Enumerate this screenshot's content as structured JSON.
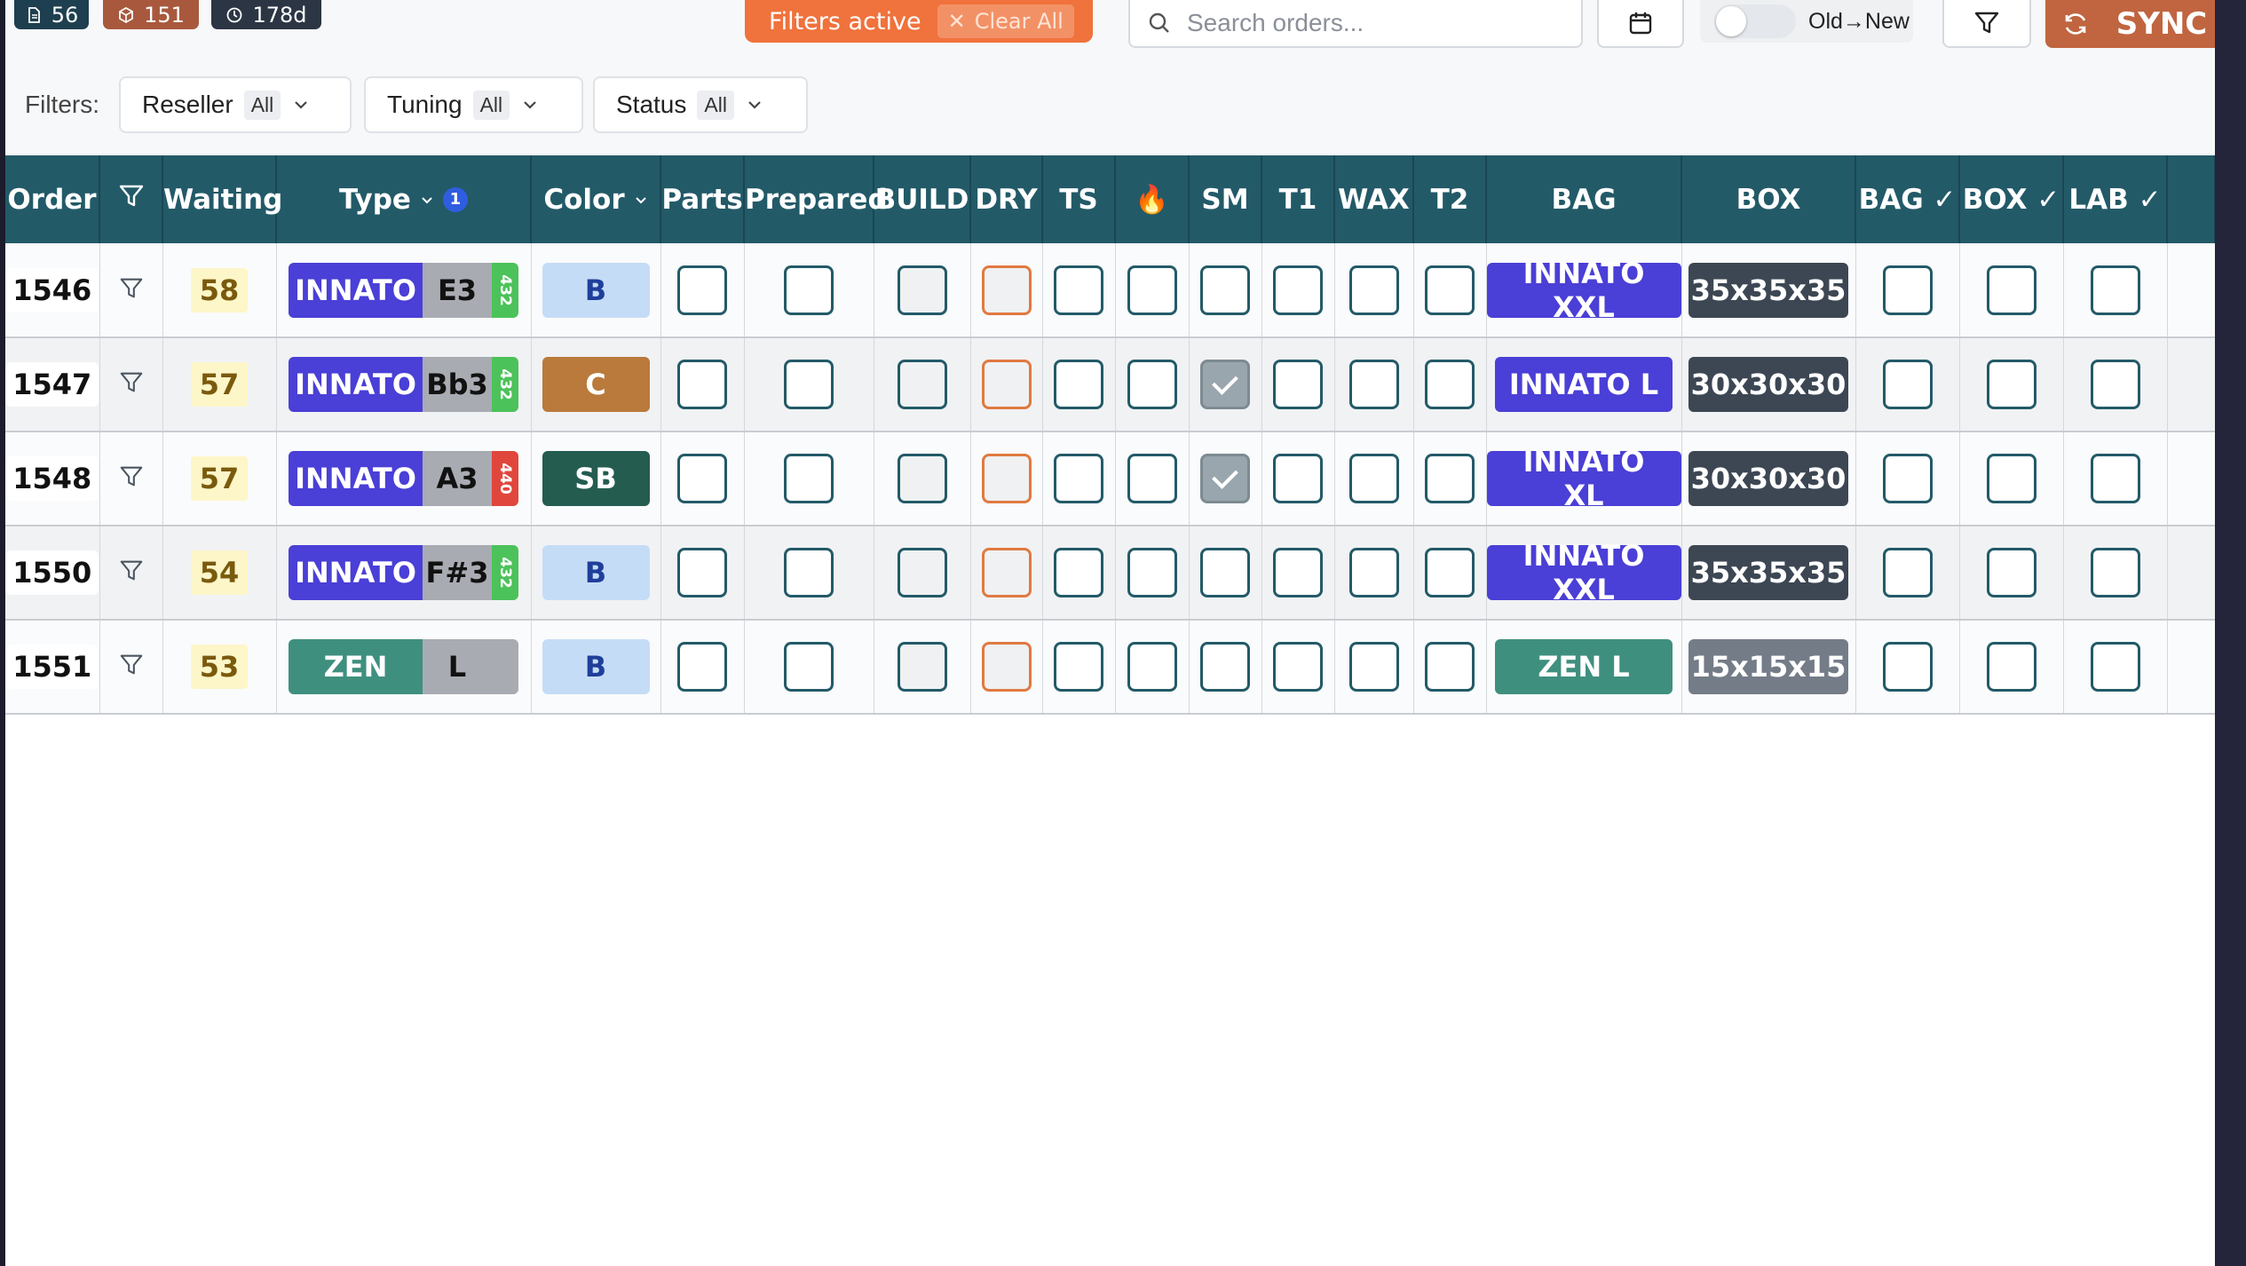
{
  "stats": {
    "docs": "56",
    "boxes": "151",
    "time": "178d",
    "docs_color": "#1e3f4f",
    "boxes_color": "#a8593d",
    "time_color": "#2b3544"
  },
  "header": {
    "filters_active": "Filters active",
    "clear_all": "Clear All",
    "search_placeholder": "Search orders...",
    "sort_label": "Old→New",
    "sync_label": "SYNC"
  },
  "filters": {
    "label": "Filters:",
    "reseller": {
      "label": "Reseller",
      "value": "All"
    },
    "tuning": {
      "label": "Tuning",
      "value": "All"
    },
    "status": {
      "label": "Status",
      "value": "All"
    }
  },
  "columns": {
    "order": "Order",
    "waiting": "Waiting",
    "type": "Type",
    "type_sort_badge": "1",
    "color": "Color",
    "parts": "Parts",
    "prepared": "Prepared",
    "build": "BUILD",
    "dry": "DRY",
    "ts": "TS",
    "fire": "🔥",
    "sm": "SM",
    "t1": "T1",
    "wax": "WAX",
    "t2": "T2",
    "bag": "BAG",
    "box": "BOX",
    "bag_check": "BAG ✓",
    "box_check": "BOX ✓",
    "lab_check": "LAB ✓"
  },
  "colors": {
    "header_bg": "#235a68",
    "innato": "#4a3fd6",
    "zen": "#3f8f7f",
    "tune_432": "#4cc25a",
    "tune_440": "#e0463c",
    "accent_orange": "#f0723c",
    "sync_bg": "#c0653f"
  },
  "rows": [
    {
      "order": "1546",
      "waiting": "58",
      "model": "INNATO",
      "key": "E3",
      "tuning": "432",
      "color": "B",
      "sm": false,
      "bag": "INNATO XXL",
      "box": "35x35x35"
    },
    {
      "order": "1547",
      "waiting": "57",
      "model": "INNATO",
      "key": "Bb3",
      "tuning": "432",
      "color": "C",
      "sm": true,
      "bag": "INNATO L",
      "box": "30x30x30"
    },
    {
      "order": "1548",
      "waiting": "57",
      "model": "INNATO",
      "key": "A3",
      "tuning": "440",
      "color": "SB",
      "sm": true,
      "bag": "INNATO XL",
      "box": "30x30x30"
    },
    {
      "order": "1550",
      "waiting": "54",
      "model": "INNATO",
      "key": "F#3",
      "tuning": "432",
      "color": "B",
      "sm": false,
      "bag": "INNATO XXL",
      "box": "35x35x35"
    },
    {
      "order": "1551",
      "waiting": "53",
      "model": "ZEN",
      "key": "L",
      "tuning": "",
      "color": "B",
      "sm": false,
      "bag": "ZEN L",
      "box": "15x15x15"
    }
  ]
}
